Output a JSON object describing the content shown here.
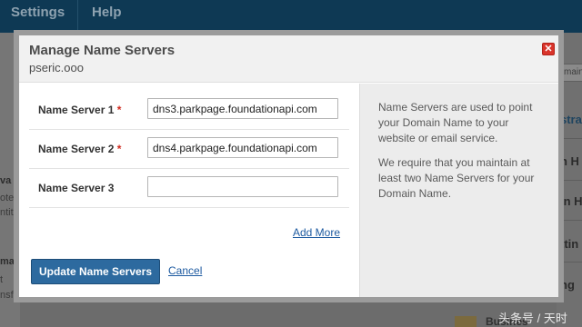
{
  "background": {
    "nav": {
      "settings": "Settings",
      "help": "Help"
    },
    "left_fragments": [
      "va",
      "ote",
      "ntit",
      "ma",
      "t",
      "nsf"
    ],
    "right_fragments": [
      "main",
      "stra",
      "n H",
      "in He",
      "ttin",
      "ng",
      "Business"
    ],
    "bottom_label": "Busines"
  },
  "modal": {
    "title": "Manage Name Servers",
    "domain": "pseric.ooo",
    "close_glyph": "✕",
    "fields": [
      {
        "label": "Name Server 1",
        "required": "*",
        "value": "dns3.parkpage.foundationapi.com"
      },
      {
        "label": "Name Server 2",
        "required": "*",
        "value": "dns4.parkpage.foundationapi.com"
      },
      {
        "label": "Name Server 3",
        "required": "",
        "value": ""
      }
    ],
    "add_more": "Add More",
    "update_button": "Update Name Servers",
    "cancel": "Cancel",
    "help": {
      "paragraph1": "Name Servers are used to point your Domain Name to your website or email service.",
      "paragraph2": "We require that you maintain at least two Name Servers for your Domain Name."
    }
  },
  "watermark": "头条号 / 天时",
  "colors": {
    "nav_bg": "#0e3954",
    "primary_button": "#2d6a9f",
    "link": "#1d5aa0",
    "required": "#d02a1f",
    "close": "#d9342b"
  }
}
